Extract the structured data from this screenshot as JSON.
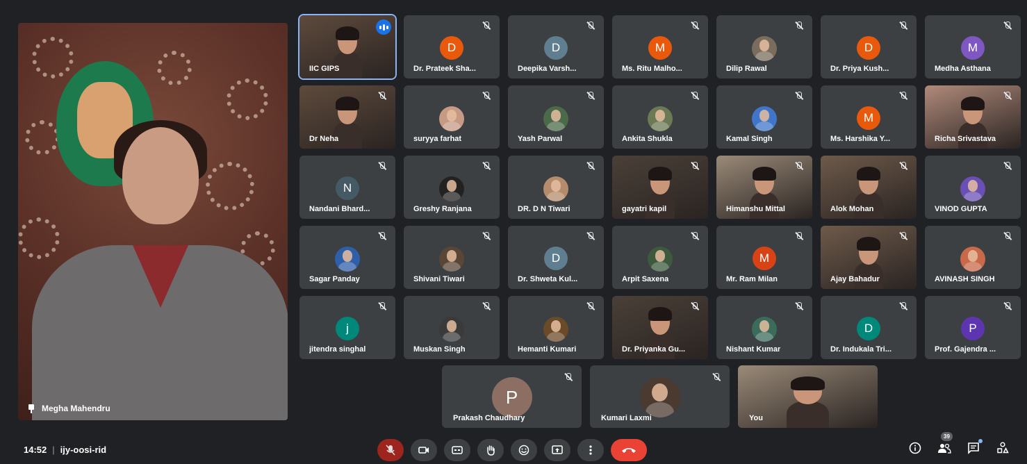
{
  "speaker": {
    "name": "Megha Mahendru"
  },
  "rows": [
    [
      {
        "name": "IIC GIPS",
        "kind": "video",
        "highlight": true,
        "speaking": true
      },
      {
        "name": "Dr. Prateek Sha...",
        "kind": "letter",
        "letter": "D",
        "color": "#e8590c"
      },
      {
        "name": "Deepika Varsh...",
        "kind": "letter",
        "letter": "D",
        "color": "#5f7e8f"
      },
      {
        "name": "Ms. Ritu Malho...",
        "kind": "letter",
        "letter": "M",
        "color": "#e8590c"
      },
      {
        "name": "Dilip Rawal",
        "kind": "photo",
        "photo": "#7b6d5d"
      },
      {
        "name": "Dr. Priya Kush...",
        "kind": "letter",
        "letter": "D",
        "color": "#e8590c"
      },
      {
        "name": "Medha Asthana",
        "kind": "letter",
        "letter": "M",
        "color": "#7e57c2"
      }
    ],
    [
      {
        "name": "Dr Neha",
        "kind": "video"
      },
      {
        "name": "suryya farhat",
        "kind": "photo",
        "photo": "#c79a86"
      },
      {
        "name": "Yash Parwal",
        "kind": "photo",
        "photo": "#4a6a4a"
      },
      {
        "name": "Ankita Shukla",
        "kind": "photo",
        "photo": "#6b7a55"
      },
      {
        "name": "Kamal Singh",
        "kind": "photo",
        "photo": "#3f76c9"
      },
      {
        "name": "Ms. Harshika Y...",
        "kind": "letter",
        "letter": "M",
        "color": "#e8590c"
      },
      {
        "name": "Richa Srivastava",
        "kind": "video"
      }
    ],
    [
      {
        "name": "Nandani Bhard...",
        "kind": "letter",
        "letter": "N",
        "color": "#455a64"
      },
      {
        "name": "Greshy Ranjana",
        "kind": "photo",
        "photo": "#222222"
      },
      {
        "name": "DR. D N Tiwari",
        "kind": "photo",
        "photo": "#b58b6b"
      },
      {
        "name": "gayatri kapil",
        "kind": "video"
      },
      {
        "name": "Himanshu Mittal",
        "kind": "video"
      },
      {
        "name": "Alok Mohan",
        "kind": "video"
      },
      {
        "name": "VINOD GUPTA",
        "kind": "photo",
        "photo": "#6a4fb5"
      }
    ],
    [
      {
        "name": "Sagar Panday",
        "kind": "photo",
        "photo": "#2f5fa8"
      },
      {
        "name": "Shivani Tiwari",
        "kind": "photo",
        "photo": "#5a4636"
      },
      {
        "name": "Dr. Shweta Kul...",
        "kind": "letter",
        "letter": "D",
        "color": "#5f7e8f"
      },
      {
        "name": "Arpit Saxena",
        "kind": "photo",
        "photo": "#3e5a3e"
      },
      {
        "name": "Mr. Ram Milan",
        "kind": "letter",
        "letter": "M",
        "color": "#d84315"
      },
      {
        "name": "Ajay Bahadur",
        "kind": "video"
      },
      {
        "name": "AVINASH SINGH",
        "kind": "photo",
        "photo": "#c86a4a"
      }
    ],
    [
      {
        "name": "jitendra singhal",
        "kind": "letter",
        "letter": "j",
        "color": "#00897b"
      },
      {
        "name": "Muskan Singh",
        "kind": "photo",
        "photo": "#3a3a3a"
      },
      {
        "name": "Hemanti Kumari",
        "kind": "photo",
        "photo": "#6b4a2a"
      },
      {
        "name": "Dr. Priyanka Gu...",
        "kind": "video"
      },
      {
        "name": "Nishant Kumar",
        "kind": "photo",
        "photo": "#3b6b5b"
      },
      {
        "name": "Dr. Indukala Tri...",
        "kind": "letter",
        "letter": "D",
        "color": "#00897b"
      },
      {
        "name": "Prof. Gajendra ...",
        "kind": "letter",
        "letter": "P",
        "color": "#5e35b1"
      }
    ]
  ],
  "bottom": [
    {
      "name": "Prakash Chaudhary",
      "kind": "letter",
      "letter": "P",
      "color": "#8d6e63"
    },
    {
      "name": "Kumari Laxmi",
      "kind": "photo",
      "photo": "#4a3a30"
    },
    {
      "name": "You",
      "kind": "video"
    }
  ],
  "bar": {
    "time": "14:52",
    "separator": "|",
    "code": "ijy-oosi-rid",
    "participant_count": "39"
  },
  "icons": {
    "mic": "mic-off-icon",
    "camera": "camera-icon",
    "cc": "captions-icon",
    "hand": "raise-hand-icon",
    "emoji": "emoji-icon",
    "present": "present-icon",
    "more": "more-icon",
    "hangup": "hangup-icon",
    "info": "info-icon",
    "people": "people-icon",
    "chat": "chat-icon",
    "activities": "activities-icon"
  }
}
